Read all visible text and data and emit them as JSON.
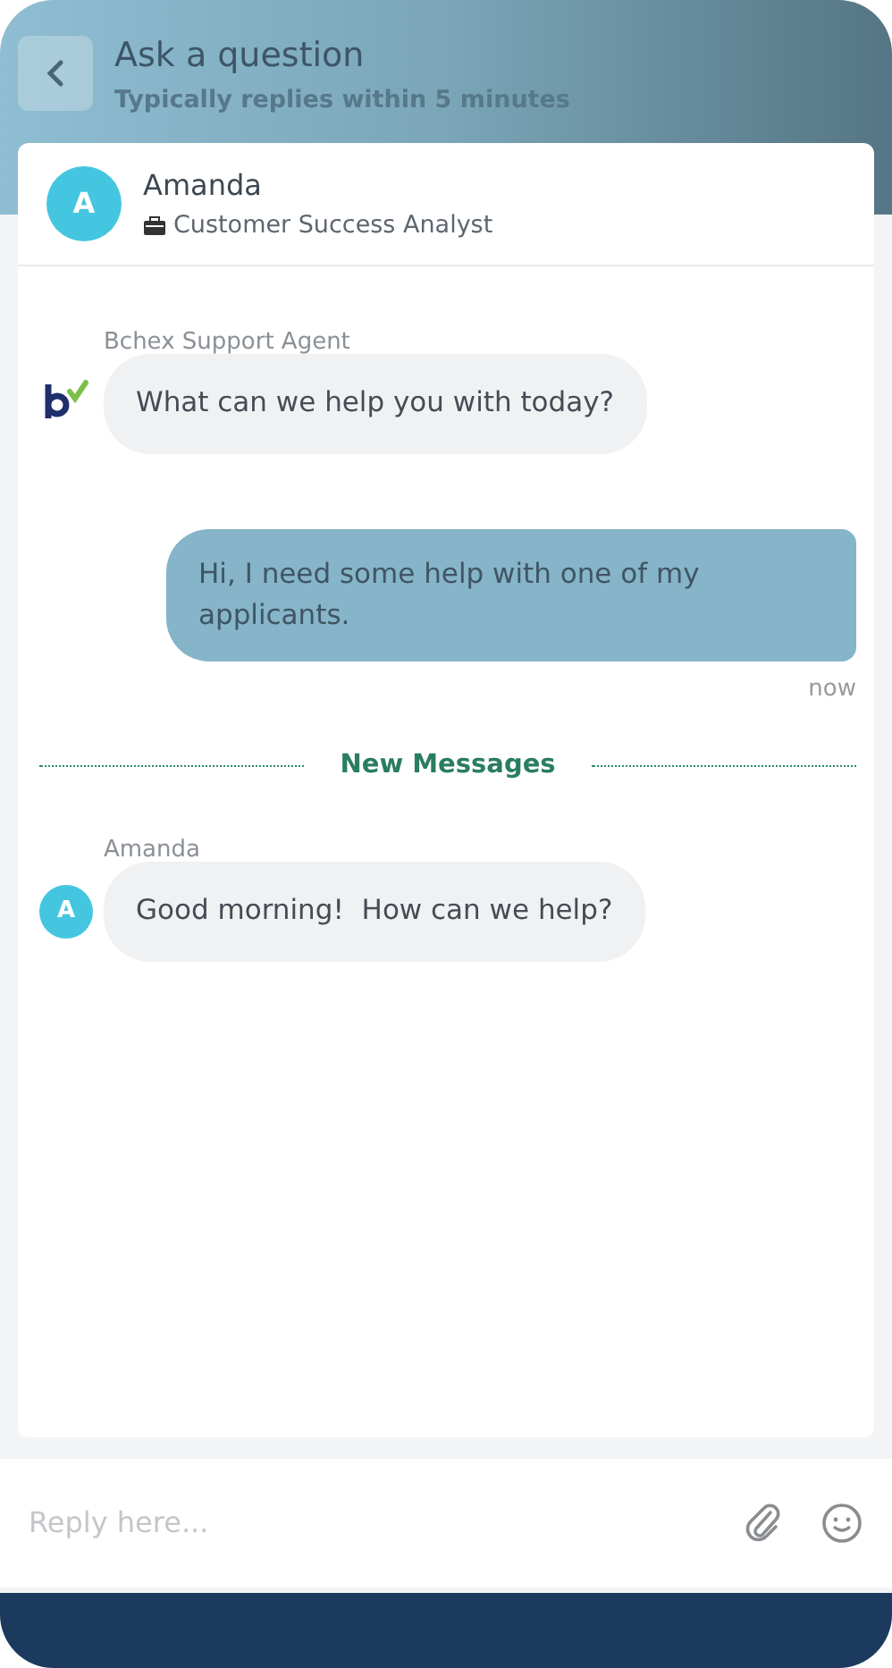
{
  "header": {
    "title": "Ask a question",
    "subtitle": "Typically replies within 5 minutes"
  },
  "agent": {
    "initial": "A",
    "name": "Amanda",
    "role": "Customer Success Analyst"
  },
  "messages": [
    {
      "kind": "incoming",
      "sender": "Bchex Support Agent",
      "avatar": {
        "kind": "logo"
      },
      "text": "What can we help you with today?"
    },
    {
      "kind": "outgoing",
      "text": "Hi, I need some help with one of my applicants.",
      "time": "now"
    },
    {
      "kind": "divider",
      "text": "New Messages"
    },
    {
      "kind": "incoming",
      "sender": "Amanda",
      "avatar": {
        "kind": "initial",
        "initial": "A"
      },
      "text": "Good morning!  How can we help?"
    }
  ],
  "composer": {
    "placeholder": "Reply here..."
  }
}
